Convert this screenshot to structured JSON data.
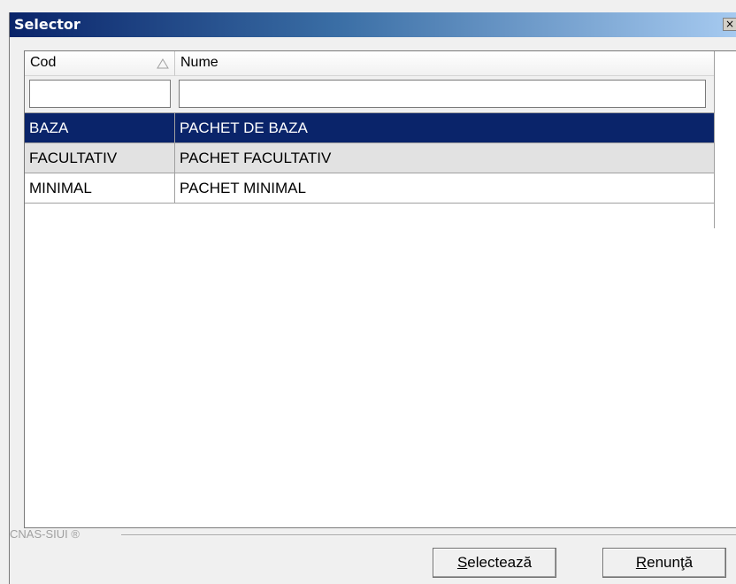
{
  "window": {
    "title": "Selector",
    "close_glyph": "×"
  },
  "grid": {
    "columns": [
      {
        "label": "Cod",
        "sorted": "ascending"
      },
      {
        "label": "Nume"
      }
    ],
    "filters": {
      "cod_value": "",
      "nume_value": ""
    },
    "rows": [
      {
        "cod": "BAZA",
        "nume": "PACHET DE BAZA",
        "state": "selected"
      },
      {
        "cod": "FACULTATIV",
        "nume": "PACHET FACULTATIV",
        "state": "alternate"
      },
      {
        "cod": "MINIMAL",
        "nume": "PACHET MINIMAL",
        "state": "normal"
      }
    ]
  },
  "footer": {
    "label": "CNAS-SIUI ®",
    "select_button": {
      "accel": "S",
      "rest": "electează"
    },
    "cancel_button": {
      "accel": "R",
      "rest": "enunţă"
    }
  },
  "colors": {
    "selection": "#0a246a",
    "alternate_row": "#e2e2e2",
    "titlebar_start": "#0a246a",
    "titlebar_end": "#a6caf0"
  }
}
